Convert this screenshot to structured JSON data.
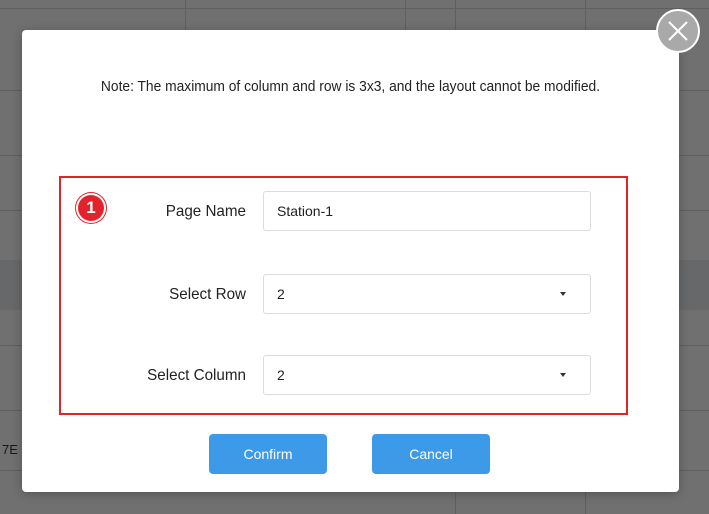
{
  "background": {
    "stub_text": "7E"
  },
  "dialog": {
    "note": "Note: The maximum of column and row is 3x3, and the layout cannot be modified.",
    "close_icon": "close-x-icon",
    "step_number": "1",
    "page_name_label": "Page Name",
    "page_name_value": "Station-1",
    "select_row_label": "Select Row",
    "select_row_value": "2",
    "select_column_label": "Select Column",
    "select_column_value": "2",
    "confirm_label": "Confirm",
    "cancel_label": "Cancel"
  },
  "colors": {
    "accent_blue": "#3c9ae8",
    "highlight_red": "#e3232b",
    "close_gray": "#a9a9a9"
  }
}
